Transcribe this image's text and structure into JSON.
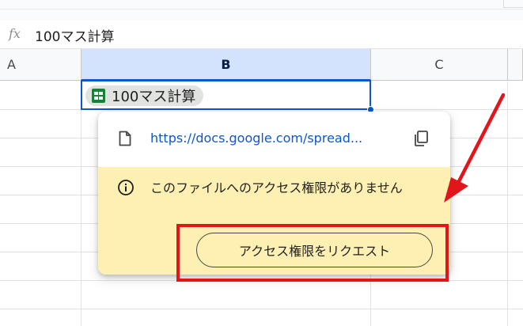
{
  "formula_bar": {
    "fx_label": "fx",
    "content": "100マス計算"
  },
  "columns": [
    "A",
    "B",
    "C"
  ],
  "selected_cell": {
    "chip_label": "100マス計算",
    "chip_icon": "google-sheets-icon"
  },
  "link_popup": {
    "url": "https://docs.google.com/spread...",
    "doc_icon": "document-icon",
    "copy_icon": "copy-icon",
    "warning_icon": "info-icon",
    "warning_message": "このファイルへのアクセス権限がありません",
    "request_button_label": "アクセス権限をリクエスト"
  },
  "colors": {
    "accent": "#0b57d0",
    "warning_background": "#fef0b2",
    "annotation_red": "#e2151b",
    "sheets_green": "#188038"
  }
}
